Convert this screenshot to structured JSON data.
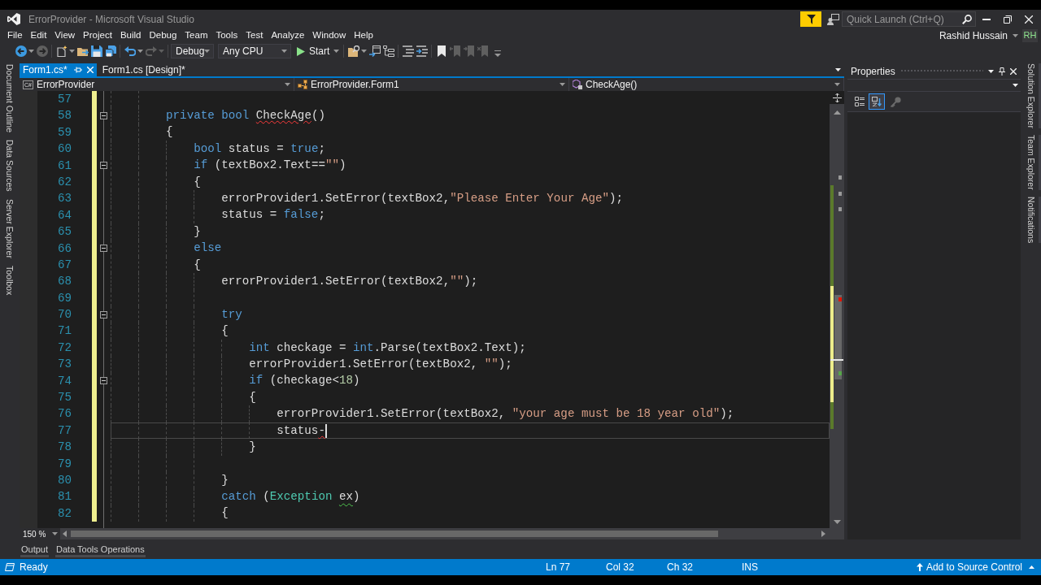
{
  "title_bar": {
    "title": "ErrorProvider - Microsoft Visual Studio",
    "quick_launch": {
      "placeholder": "Quick Launch (Ctrl+Q)"
    }
  },
  "menu": [
    "File",
    "Edit",
    "View",
    "Project",
    "Build",
    "Debug",
    "Team",
    "Tools",
    "Test",
    "Analyze",
    "Window",
    "Help"
  ],
  "account": {
    "name": "Rashid Hussain",
    "initials": "RH"
  },
  "toolbar": [
    {
      "kind": "back",
      "disabled": false
    },
    {
      "kind": "forward",
      "disabled": true
    },
    {
      "kind": "new_project",
      "disabled": false
    },
    {
      "kind": "open",
      "disabled": false
    },
    {
      "kind": "save",
      "disabled": false
    },
    {
      "kind": "save_all",
      "disabled": false
    },
    {
      "kind": "undo",
      "disabled": false
    },
    {
      "kind": "redo",
      "disabled": true
    },
    {
      "kind": "configuration",
      "text": "Debug"
    },
    {
      "kind": "platform",
      "text": "Any CPU"
    },
    {
      "kind": "start",
      "text": "Start"
    },
    {
      "kind": "find",
      "disabled": false
    },
    {
      "kind": "step",
      "disabled": false
    },
    {
      "kind": "tree",
      "disabled": false
    },
    {
      "kind": "comment",
      "disabled": false
    },
    {
      "kind": "uncomment",
      "disabled": false
    },
    {
      "kind": "bookmark",
      "disabled": false
    },
    {
      "kind": "previous_bookmark",
      "disabled": true
    },
    {
      "kind": "next_bookmark",
      "disabled": true
    },
    {
      "kind": "clear_bookmarks",
      "disabled": true
    }
  ],
  "left_tool_tabs": [
    "Document Outline",
    "Data Sources",
    "Server Explorer",
    "Toolbox"
  ],
  "document_tabs": [
    {
      "label": "Form1.cs*",
      "selected": true
    },
    {
      "label": "Form1.cs [Design]*",
      "selected": false
    }
  ],
  "navigation_bar": {
    "language": "C#",
    "project": "ErrorProvider",
    "type": "ErrorProvider.Form1",
    "member": "CheckAge()"
  },
  "editor": {
    "zoom": "150 %",
    "lines": [
      {
        "number": "57",
        "changed": true,
        "foldable": false,
        "current": false
      },
      {
        "number": "58",
        "changed": true,
        "foldable": true,
        "current": false,
        "tokens": [
          {
            "text": "        private bool ",
            "kind": "keyword",
            "error": false,
            "warning": false
          },
          {
            "text": "CheckAge",
            "kind": "plain",
            "error": true,
            "warning": false
          },
          {
            "text": "()",
            "kind": "plain",
            "error": false,
            "warning": false
          }
        ]
      },
      {
        "number": "59",
        "changed": true,
        "foldable": false,
        "current": false,
        "tokens": [
          {
            "text": "        {",
            "kind": "plain"
          }
        ]
      },
      {
        "number": "60",
        "changed": true,
        "foldable": false,
        "current": false,
        "tokens": [
          {
            "text": "            bool",
            "kind": "keyword"
          },
          {
            "text": " status = ",
            "kind": "plain"
          },
          {
            "text": "true",
            "kind": "keyword"
          },
          {
            "text": ";",
            "kind": "plain"
          }
        ]
      },
      {
        "number": "61",
        "changed": true,
        "foldable": true,
        "current": false,
        "tokens": [
          {
            "text": "            if",
            "kind": "keyword"
          },
          {
            "text": " (textBox2.Text==",
            "kind": "plain"
          },
          {
            "text": "\"\"",
            "kind": "string"
          },
          {
            "text": ")",
            "kind": "plain"
          }
        ]
      },
      {
        "number": "62",
        "changed": true,
        "foldable": false,
        "current": false,
        "tokens": [
          {
            "text": "            {",
            "kind": "plain"
          }
        ]
      },
      {
        "number": "63",
        "changed": true,
        "foldable": false,
        "current": false,
        "tokens": [
          {
            "text": "                errorProvider1.SetError(textBox2,",
            "kind": "plain"
          },
          {
            "text": "\"Please Enter Your Age\"",
            "kind": "string"
          },
          {
            "text": ");",
            "kind": "plain"
          }
        ]
      },
      {
        "number": "64",
        "changed": true,
        "foldable": false,
        "current": false,
        "tokens": [
          {
            "text": "                status = ",
            "kind": "plain"
          },
          {
            "text": "false",
            "kind": "keyword"
          },
          {
            "text": ";",
            "kind": "plain"
          }
        ]
      },
      {
        "number": "65",
        "changed": true,
        "foldable": false,
        "current": false,
        "tokens": [
          {
            "text": "            }",
            "kind": "plain"
          }
        ]
      },
      {
        "number": "66",
        "changed": true,
        "foldable": true,
        "current": false,
        "tokens": [
          {
            "text": "            else",
            "kind": "keyword"
          }
        ]
      },
      {
        "number": "67",
        "changed": true,
        "foldable": false,
        "current": false,
        "tokens": [
          {
            "text": "            {",
            "kind": "plain"
          }
        ]
      },
      {
        "number": "68",
        "changed": true,
        "foldable": false,
        "current": false,
        "tokens": [
          {
            "text": "                errorProvider1.SetError(textBox2,",
            "kind": "plain"
          },
          {
            "text": "\"\"",
            "kind": "string"
          },
          {
            "text": ");",
            "kind": "plain"
          }
        ]
      },
      {
        "number": "69",
        "changed": true,
        "foldable": false,
        "current": false
      },
      {
        "number": "70",
        "changed": true,
        "foldable": true,
        "current": false,
        "tokens": [
          {
            "text": "                try",
            "kind": "keyword"
          }
        ]
      },
      {
        "number": "71",
        "changed": true,
        "foldable": false,
        "current": false,
        "tokens": [
          {
            "text": "                {",
            "kind": "plain"
          }
        ]
      },
      {
        "number": "72",
        "changed": true,
        "foldable": false,
        "current": false,
        "tokens": [
          {
            "text": "                    int",
            "kind": "keyword"
          },
          {
            "text": " checkage = ",
            "kind": "plain"
          },
          {
            "text": "int",
            "kind": "keyword"
          },
          {
            "text": ".Parse(textBox2.Text);",
            "kind": "plain"
          }
        ]
      },
      {
        "number": "73",
        "changed": true,
        "foldable": false,
        "current": false,
        "tokens": [
          {
            "text": "                    errorProvider1.SetError(textBox2, ",
            "kind": "plain"
          },
          {
            "text": "\"\"",
            "kind": "string"
          },
          {
            "text": ");",
            "kind": "plain"
          }
        ]
      },
      {
        "number": "74",
        "changed": true,
        "foldable": true,
        "current": false,
        "tokens": [
          {
            "text": "                    if",
            "kind": "keyword"
          },
          {
            "text": " (checkage<",
            "kind": "plain"
          },
          {
            "text": "18",
            "kind": "number"
          },
          {
            "text": ")",
            "kind": "plain"
          }
        ]
      },
      {
        "number": "75",
        "changed": true,
        "foldable": false,
        "current": false,
        "tokens": [
          {
            "text": "                    {",
            "kind": "plain"
          }
        ]
      },
      {
        "number": "76",
        "changed": true,
        "foldable": false,
        "current": false,
        "tokens": [
          {
            "text": "                        errorProvider1.SetError(textBox2, ",
            "kind": "plain"
          },
          {
            "text": "\"your age must be 18 year old\"",
            "kind": "string"
          },
          {
            "text": ");",
            "kind": "plain"
          }
        ]
      },
      {
        "number": "77",
        "changed": true,
        "foldable": false,
        "current": true,
        "tokens": [
          {
            "text": "                        status",
            "kind": "plain",
            "error": false,
            "warning": false
          },
          {
            "text": "-",
            "kind": "plain",
            "error": true,
            "warning": false
          }
        ]
      },
      {
        "number": "78",
        "changed": true,
        "foldable": false,
        "current": false,
        "tokens": [
          {
            "text": "                    }",
            "kind": "plain"
          }
        ]
      },
      {
        "number": "79",
        "changed": true,
        "foldable": false,
        "current": false
      },
      {
        "number": "80",
        "changed": true,
        "foldable": false,
        "current": false,
        "tokens": [
          {
            "text": "                }",
            "kind": "plain"
          }
        ]
      },
      {
        "number": "81",
        "changed": true,
        "foldable": false,
        "current": false,
        "tokens": [
          {
            "text": "                catch",
            "kind": "keyword",
            "error": false,
            "warning": false
          },
          {
            "text": " (",
            "kind": "plain",
            "error": false,
            "warning": false
          },
          {
            "text": "Exception ",
            "kind": "type",
            "error": false,
            "warning": false
          },
          {
            "text": "ex",
            "kind": "plain",
            "error": false,
            "warning": true
          },
          {
            "text": ")",
            "kind": "plain",
            "error": false,
            "warning": false
          }
        ]
      },
      {
        "number": "82",
        "changed": true,
        "foldable": false,
        "current": false,
        "tokens": [
          {
            "text": "                {",
            "kind": "plain"
          }
        ]
      }
    ]
  },
  "bottom_tool_tabs": [
    "Output",
    "Data Tools Operations"
  ],
  "properties": {
    "title": "Properties",
    "view_buttons": [
      {
        "kind": "categorized",
        "selected": false
      },
      {
        "kind": "alphabetical",
        "selected": true
      }
    ],
    "property_pages": {
      "disabled": true
    }
  },
  "right_tool_tabs": [
    "Solution Explorer",
    "Team Explorer",
    "Notifications"
  ],
  "status_bar": {
    "state": "Ready",
    "line": "Ln 77",
    "column": "Col 32",
    "character": "Ch 32",
    "mode": "INS",
    "source_control": "Add to Source Control"
  }
}
